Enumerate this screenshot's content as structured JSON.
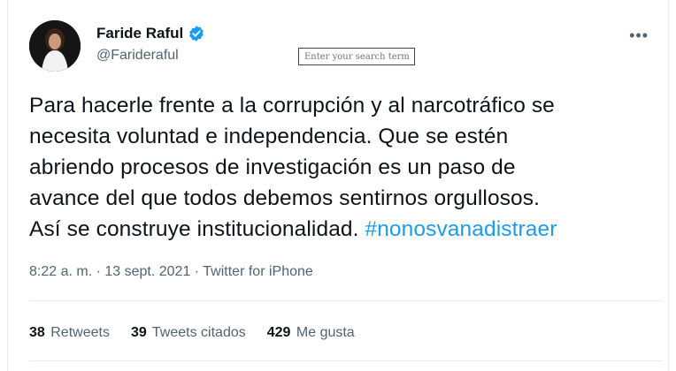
{
  "author": {
    "name": "Faride Raful",
    "handle": "@Farideraful"
  },
  "search": {
    "placeholder": "Enter your search term"
  },
  "tweet": {
    "lines": [
      "Para hacerle frente a la corrupción y al narcotráfico se",
      "necesita voluntad e independencia. Que se estén",
      "abriendo procesos de investigación es un paso de",
      "avance del que todos debemos sentirnos orgullosos.",
      "Así se construye institucionalidad. "
    ],
    "hashtag": "#nonosvanadistraer"
  },
  "meta": {
    "time": "8:22 a. m.",
    "sep1": " · ",
    "date": "13 sept. 2021",
    "sep2": " · ",
    "source": "Twitter for iPhone"
  },
  "stats": {
    "retweets_count": "38",
    "retweets_label": "Retweets",
    "quotes_count": "39",
    "quotes_label": "Tweets citados",
    "likes_count": "429",
    "likes_label": "Me gusta"
  },
  "colors": {
    "accent": "#1d9bf0",
    "secondary_text": "#536471",
    "primary_text": "#0f1419"
  },
  "icons": {
    "verified": "verified-badge-icon",
    "more": "more-options-icon"
  }
}
